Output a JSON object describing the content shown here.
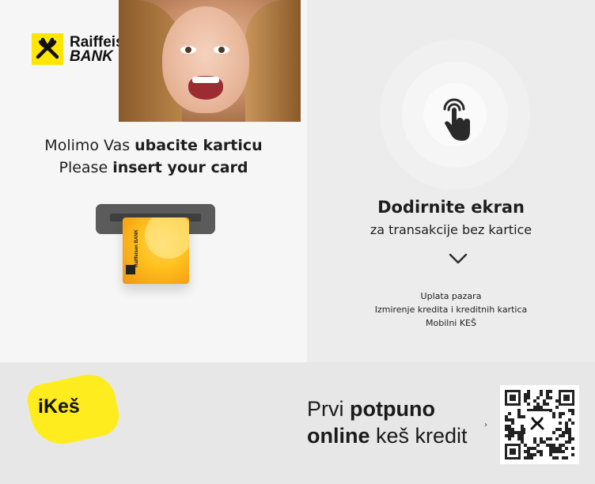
{
  "brand": {
    "name_line1": "Raiffeisen",
    "name_line2": "BANK",
    "accent_color": "#ffe600"
  },
  "insert_card": {
    "line1_regular": "Molimo Vas ",
    "line1_bold": "ubacite karticu",
    "line2_regular": "Please ",
    "line2_bold": "insert your card",
    "card_label": "Raiffeisen BANK"
  },
  "touch": {
    "title": "Dodirnite ekran",
    "subtitle": "za transakcije bez kartice",
    "icon": "touch-hand-icon",
    "expand_icon": "chevron-down-icon"
  },
  "services": [
    "Uplata pazara",
    "Izmirenje kredita i kreditnih kartica",
    "Mobilni KEŠ"
  ],
  "banner": {
    "badge_text": "iKeš",
    "promo_line1_regular": "Prvi ",
    "promo_line1_bold": "potpuno",
    "promo_line2_bold": "online",
    "promo_line2_regular": " keš kredit",
    "arrow": "›"
  }
}
